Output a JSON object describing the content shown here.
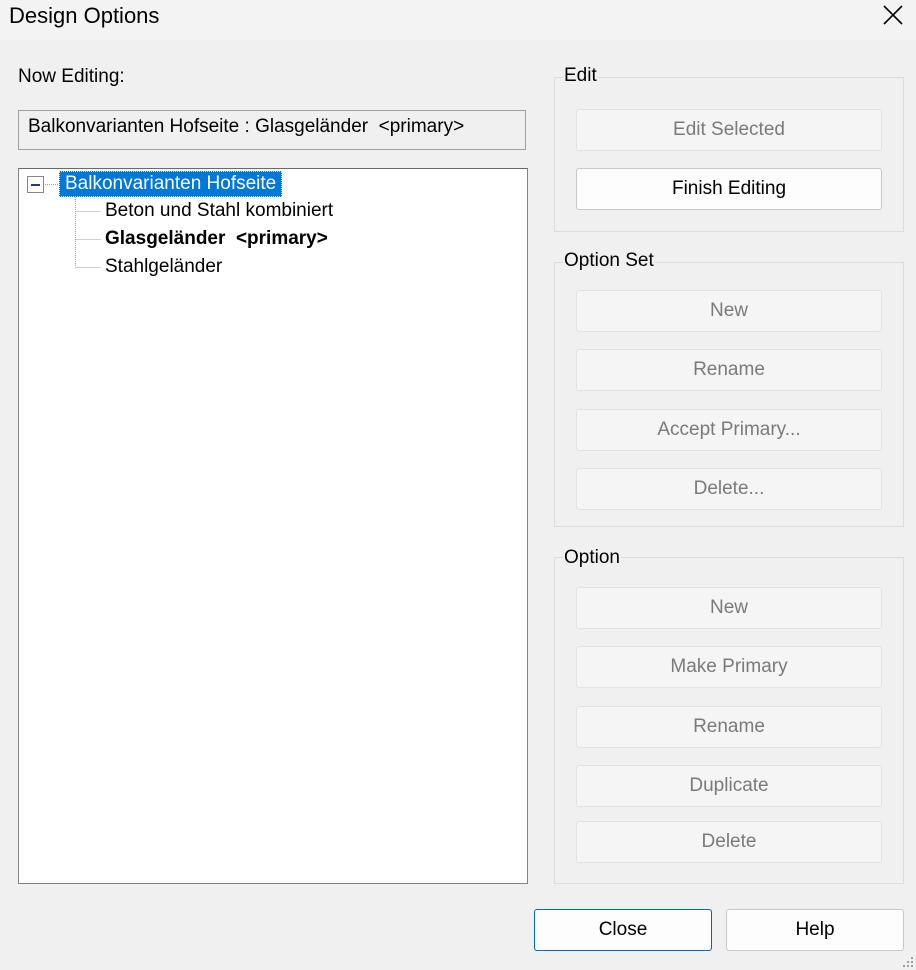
{
  "window": {
    "title": "Design Options"
  },
  "now_editing": {
    "label": "Now Editing:",
    "value": "Balkonvarianten Hofseite : Glasgeländer  <primary>"
  },
  "tree": {
    "root": {
      "label": "Balkonvarianten Hofseite",
      "selected": true,
      "expanded": true
    },
    "children": [
      {
        "label": "Beton und Stahl kombiniert",
        "bold": false
      },
      {
        "label": "Glasgeländer  <primary>",
        "bold": true
      },
      {
        "label": "Stahlgeländer",
        "bold": false
      }
    ]
  },
  "edit_group": {
    "title": "Edit",
    "edit_selected": "Edit Selected",
    "finish_editing": "Finish Editing"
  },
  "option_set_group": {
    "title": "Option Set",
    "new": "New",
    "rename": "Rename",
    "accept_primary": "Accept Primary...",
    "delete": "Delete..."
  },
  "option_group": {
    "title": "Option",
    "new": "New",
    "make_primary": "Make Primary",
    "rename": "Rename",
    "duplicate": "Duplicate",
    "delete": "Delete"
  },
  "footer": {
    "close": "Close",
    "help": "Help"
  },
  "colors": {
    "selection": "#0078d7",
    "focus_border": "#0067c0",
    "disabled_text": "#7a7a7a"
  }
}
